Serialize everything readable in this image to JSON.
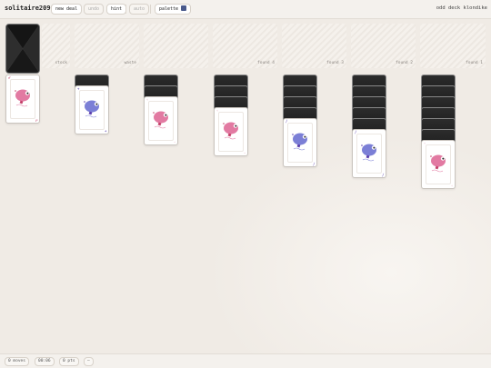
{
  "header": {
    "title": "solitaire2098",
    "buttons": {
      "new_deal": "new deal",
      "undo": "undo",
      "hint": "hint",
      "auto": "auto",
      "palette": "palette"
    },
    "palette_color": "#4a5a8c",
    "mode": "odd deck klondike"
  },
  "slots": {
    "stock": "stock",
    "waste": "waste",
    "foundations": [
      "found 4",
      "found 3",
      "found 2",
      "found 1"
    ]
  },
  "colors": {
    "pink_ink": "#c4416a",
    "blue_ink": "#5b3fae",
    "card_back": "#1f1f1f"
  },
  "tableau": [
    {
      "face_down": 0,
      "top_card": {
        "corner": "♂",
        "creature": "pink-blob",
        "color": "#e27aa2"
      }
    },
    {
      "face_down": 1,
      "top_card": {
        "corner": "+",
        "creature": "blue-blob",
        "color": "#7b7fd6"
      }
    },
    {
      "face_down": 2,
      "top_card": {
        "corner": "◦",
        "creature": "pink-blob",
        "color": "#e27aa2"
      }
    },
    {
      "face_down": 3,
      "top_card": {
        "corner": "◦",
        "creature": "pink-blob",
        "color": "#e27aa2"
      }
    },
    {
      "face_down": 4,
      "top_card": {
        "corner": "/",
        "creature": "blue-blob",
        "color": "#7b7fd6"
      }
    },
    {
      "face_down": 5,
      "top_card": {
        "corner": "/",
        "creature": "blue-blob",
        "color": "#7b7fd6"
      }
    },
    {
      "face_down": 6,
      "top_card": {
        "corner": "◦",
        "creature": "pink-blob",
        "color": "#e27aa2"
      }
    }
  ],
  "footer": {
    "moves": "0 moves",
    "time": "00:06",
    "points": "0 pts",
    "extra": "—"
  }
}
